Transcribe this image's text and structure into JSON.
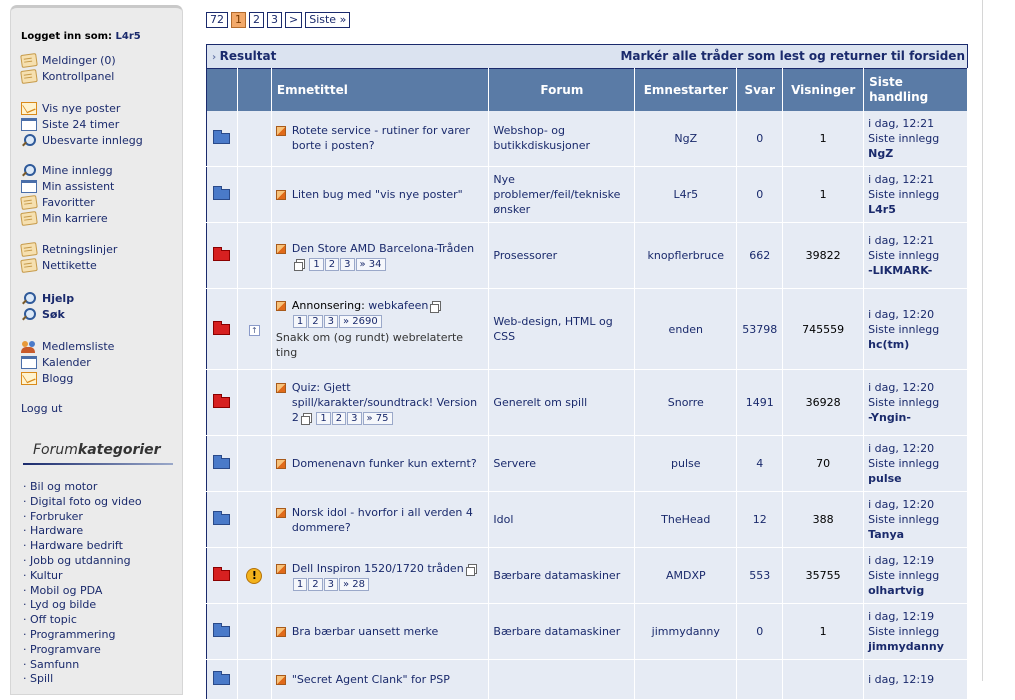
{
  "sidebar": {
    "logged_in_label": "Logget inn som:",
    "username": "L4r5",
    "group1": [
      {
        "label": "Meldinger (0)",
        "icon": "note-icon"
      },
      {
        "label": "Kontrollpanel",
        "icon": "note-icon"
      }
    ],
    "group2": [
      {
        "label": "Vis nye poster",
        "icon": "mail-icon"
      },
      {
        "label": "Siste 24 timer",
        "icon": "calendar-icon"
      },
      {
        "label": "Ubesvarte innlegg",
        "icon": "search-icon"
      }
    ],
    "group3": [
      {
        "label": "Mine innlegg",
        "icon": "search-icon"
      },
      {
        "label": "Min assistent",
        "icon": "calendar-icon"
      },
      {
        "label": "Favoritter",
        "icon": "note-icon"
      },
      {
        "label": "Min karriere",
        "icon": "note-icon"
      }
    ],
    "group4": [
      {
        "label": "Retningslinjer",
        "icon": "note-icon"
      },
      {
        "label": "Nettikette",
        "icon": "note-icon"
      }
    ],
    "group5": [
      {
        "label": "Hjelp",
        "icon": "search-icon"
      },
      {
        "label": "Søk",
        "icon": "search-icon"
      }
    ],
    "group6": [
      {
        "label": "Medlemsliste",
        "icon": "people-icon"
      },
      {
        "label": "Kalender",
        "icon": "calendar-icon"
      },
      {
        "label": "Blogg",
        "icon": "mail-icon"
      }
    ],
    "logout": "Logg ut",
    "categories_title_a": "Forum",
    "categories_title_b": "kategorier",
    "categories": [
      "Bil og motor",
      "Digital foto og video",
      "Forbruker",
      "Hardware",
      "Hardware bedrift",
      "Jobb og utdanning",
      "Kultur",
      "Mobil og PDA",
      "Lyd og bilde",
      "Off topic",
      "Programmering",
      "Programvare",
      "Samfunn",
      "Spill"
    ]
  },
  "pager": {
    "total": "72",
    "pages": [
      "1",
      "2",
      "3"
    ],
    "current": "1",
    "next": ">",
    "last": "Siste »"
  },
  "result_bar": {
    "title": "Resultat",
    "mark_all": "Markér alle tråder som lest og returner til forsiden"
  },
  "table": {
    "headers": {
      "title": "Emnetittel",
      "forum": "Forum",
      "starter": "Emnestarter",
      "replies": "Svar",
      "views": "Visninger",
      "last": "Siste handling"
    },
    "rows": [
      {
        "hot": false,
        "flag": "",
        "prefix": "",
        "prefix_link": "",
        "title": "Rotete service - rutiner for varer borte i posten?",
        "pages": [],
        "more": "",
        "subtitle": "",
        "forum": "Webshop- og butikkdiskusjoner",
        "starter": "NgZ",
        "replies": "0",
        "views": "1",
        "last_time": "i dag, 12:21",
        "last_label": "Siste innlegg",
        "last_user": "NgZ"
      },
      {
        "hot": false,
        "flag": "",
        "prefix": "",
        "prefix_link": "",
        "title": "Liten bug med \"vis nye poster\"",
        "pages": [],
        "more": "",
        "subtitle": "",
        "forum": "Nye problemer/feil/tekniske ønsker",
        "starter": "L4r5",
        "replies": "0",
        "views": "1",
        "last_time": "i dag, 12:21",
        "last_label": "Siste innlegg",
        "last_user": "L4r5"
      },
      {
        "hot": true,
        "flag": "",
        "prefix": "",
        "prefix_link": "",
        "title": "Den Store AMD Barcelona-Tråden",
        "pages": [
          "1",
          "2",
          "3"
        ],
        "more": "» 34",
        "subtitle": "",
        "forum": "Prosessorer",
        "starter": "knopflerbruce",
        "replies": "662",
        "views": "39822",
        "last_time": "i dag, 12:21",
        "last_label": "Siste innlegg",
        "last_user": "-LIKMARK-"
      },
      {
        "hot": true,
        "flag": "sticky",
        "prefix": "Annonsering:",
        "prefix_link": "webkafeen",
        "title": "",
        "pages": [
          "1",
          "2",
          "3"
        ],
        "more": "» 2690",
        "subtitle": "Snakk om (og rundt) webrelaterte ting",
        "forum": "Web-design, HTML og CSS",
        "starter": "enden",
        "replies": "53798",
        "views": "745559",
        "last_time": "i dag, 12:20",
        "last_label": "Siste innlegg",
        "last_user": "hc(tm)"
      },
      {
        "hot": true,
        "flag": "",
        "prefix": "",
        "prefix_link": "",
        "title": "Quiz: Gjett spill/karakter/soundtrack! Version 2",
        "pages": [
          "1",
          "2",
          "3"
        ],
        "more": "» 75",
        "subtitle": "",
        "forum": "Generelt om spill",
        "starter": "Snorre",
        "replies": "1491",
        "views": "36928",
        "last_time": "i dag, 12:20",
        "last_label": "Siste innlegg",
        "last_user": "-Yngin-"
      },
      {
        "hot": false,
        "flag": "",
        "prefix": "",
        "prefix_link": "",
        "title": "Domenenavn funker kun externt?",
        "pages": [],
        "more": "",
        "subtitle": "",
        "forum": "Servere",
        "starter": "pulse",
        "replies": "4",
        "views": "70",
        "last_time": "i dag, 12:20",
        "last_label": "Siste innlegg",
        "last_user": "pulse"
      },
      {
        "hot": false,
        "flag": "",
        "prefix": "",
        "prefix_link": "",
        "title": "Norsk idol - hvorfor i all verden 4 dommere?",
        "pages": [],
        "more": "",
        "subtitle": "",
        "forum": "Idol",
        "starter": "TheHead",
        "replies": "12",
        "views": "388",
        "last_time": "i dag, 12:20",
        "last_label": "Siste innlegg",
        "last_user": "Tanya"
      },
      {
        "hot": true,
        "flag": "warning",
        "prefix": "",
        "prefix_link": "",
        "title": "Dell Inspiron 1520/1720 tråden",
        "pages": [
          "1",
          "2",
          "3"
        ],
        "more": "» 28",
        "subtitle": "",
        "forum": "Bærbare datamaskiner",
        "starter": "AMDXP",
        "replies": "553",
        "views": "35755",
        "last_time": "i dag, 12:19",
        "last_label": "Siste innlegg",
        "last_user": "olhartvig"
      },
      {
        "hot": false,
        "flag": "",
        "prefix": "",
        "prefix_link": "",
        "title": "Bra bærbar uansett merke",
        "pages": [],
        "more": "",
        "subtitle": "",
        "forum": "Bærbare datamaskiner",
        "starter": "jimmydanny",
        "replies": "0",
        "views": "1",
        "last_time": "i dag, 12:19",
        "last_label": "Siste innlegg",
        "last_user": "jimmydanny"
      },
      {
        "hot": false,
        "flag": "",
        "prefix": "",
        "prefix_link": "",
        "title": "\"Secret Agent Clank\" for PSP",
        "pages": [],
        "more": "",
        "subtitle": "",
        "forum": "",
        "starter": "",
        "replies": "",
        "views": "",
        "last_time": "i dag, 12:19",
        "last_label": "",
        "last_user": ""
      }
    ]
  }
}
